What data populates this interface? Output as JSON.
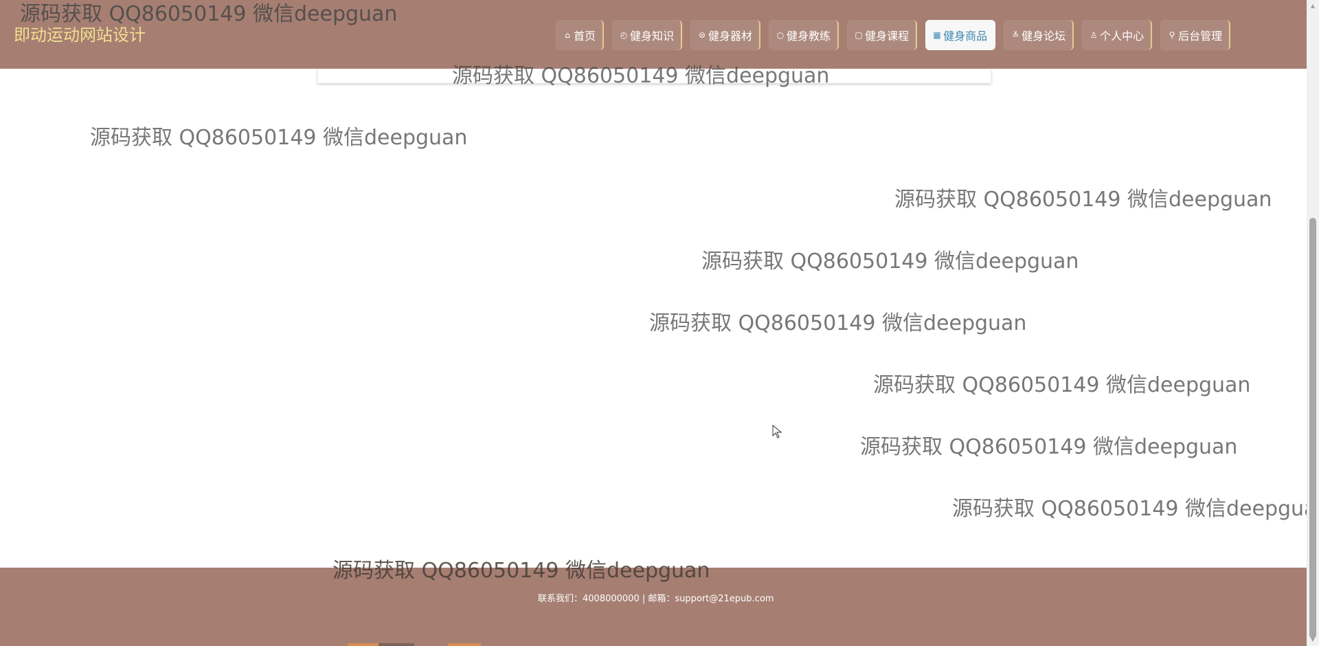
{
  "brand": {
    "title": "即动运动网站设计"
  },
  "navigation": {
    "items": [
      {
        "icon": "home-icon",
        "glyph": "⌂",
        "label": "首页"
      },
      {
        "icon": "knowledge-icon",
        "glyph": "◴",
        "label": "健身知识"
      },
      {
        "icon": "equipment-icon",
        "glyph": "⊜",
        "label": "健身器材"
      },
      {
        "icon": "coach-icon",
        "glyph": "○",
        "label": "健身教练"
      },
      {
        "icon": "course-icon",
        "glyph": "▢",
        "label": "健身课程"
      },
      {
        "icon": "products-icon",
        "glyph": "▦",
        "label": "健身商品",
        "active": true
      },
      {
        "icon": "forum-icon",
        "glyph": "≚",
        "label": "健身论坛"
      },
      {
        "icon": "user-icon",
        "glyph": "♙",
        "label": "个人中心"
      },
      {
        "icon": "link-icon",
        "glyph": "⚲",
        "label": "后台管理"
      }
    ]
  },
  "watermark": {
    "text": "源码获取 QQ86050149 微信deepguan"
  },
  "footer": {
    "contact": "联系我们：4008000000 | 邮箱：support@21epub.com"
  },
  "colors": {
    "header_background": "#a67f72",
    "brand_text": "#f1df8f",
    "active_nav_text": "#3f88b0",
    "footer_background": "#a67f72"
  }
}
